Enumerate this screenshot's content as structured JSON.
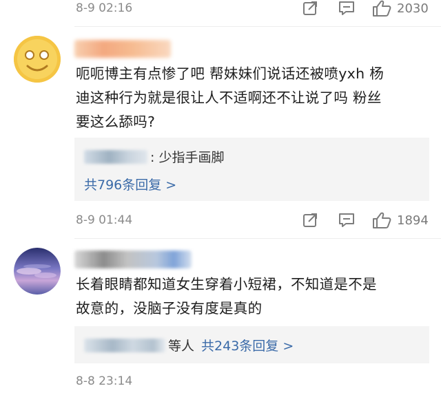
{
  "comments": [
    {
      "timestamp": "8-9 02:16",
      "likes": "2030"
    },
    {
      "text_lines": [
        "呃呃博主有点惨了吧 帮妹妹们说话还被喷yxh 杨",
        "迪这种行为就是很让人不适啊还不让说了吗 粉丝",
        "要这么舔吗?"
      ],
      "reply_preview": ": 少指手画脚",
      "reply_more": "共796条回复 >",
      "timestamp": "8-9 01:44",
      "likes": "1894"
    },
    {
      "text_lines": [
        "长着眼睛都知道女生穿着小短裙，不知道是不是",
        "故意的，没脑子没有度是真的"
      ],
      "reply_suffix": "等人",
      "reply_more": "共243条回复 >",
      "timestamp": "8-8 23:14"
    }
  ],
  "icons": {
    "share": "share-icon",
    "comment": "comment-icon",
    "like": "thumbs-up-icon"
  },
  "colors": {
    "link": "#3a6aa8",
    "meta_text": "#8a8a8a",
    "reply_bg": "#f4f4f4"
  }
}
